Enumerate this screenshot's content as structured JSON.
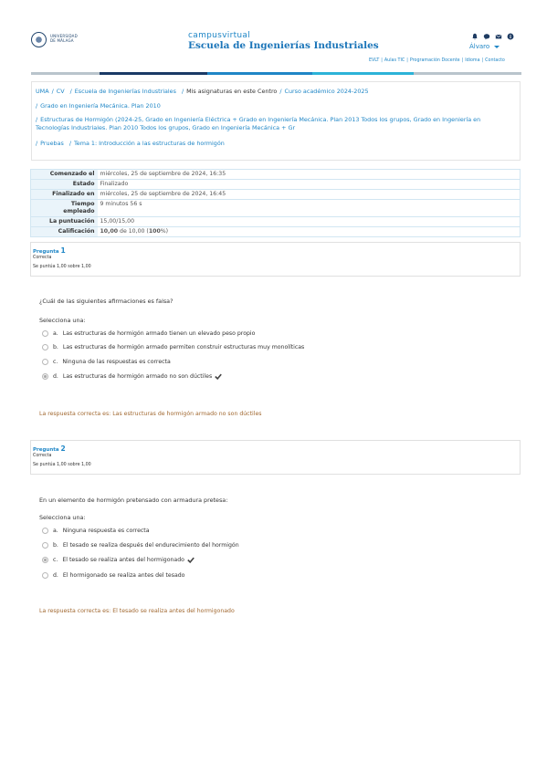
{
  "header": {
    "logo_text": "UNIVERSIDAD DE MÁLAGA",
    "site_sub": "campusvirtual",
    "site_title": "Escuela de Ingenierías Industriales",
    "user_name": "Álvaro",
    "icons": [
      "bell-icon",
      "chat-icon",
      "envelope-icon",
      "info-icon"
    ],
    "links": [
      "EVLT",
      "Aulas TIC",
      "Programación Docente",
      "Idioma",
      "Contacto"
    ]
  },
  "colorbar": [
    "#b9c4cc",
    "#1a3a66",
    "#1f86c6",
    "#2cb3d8",
    "#b9c4cc"
  ],
  "breadcrumb": {
    "line1": [
      {
        "text": "UMA",
        "link": true
      },
      {
        "text": "CV",
        "link": true
      },
      {
        "text": "Escuela de Ingenierías Industriales",
        "link": true
      },
      {
        "text": "Mis asignaturas en este Centro",
        "link": false
      },
      {
        "text": "Curso académico 2024-2025",
        "link": true
      }
    ],
    "line2": "Grado en Ingeniería Mecánica. Plan 2010",
    "line3": "Estructuras de Hormigón (2024-25, Grado en Ingeniería Eléctrica + Grado en Ingeniería Mecánica. Plan 2013 Todos los grupos, Grado en Ingeniería en Tecnologías Industriales. Plan 2010 Todos los grupos, Grado en Ingeniería Mecánica + Gr",
    "line4": [
      {
        "text": "Pruebas"
      },
      {
        "text": "Tema 1: Introducción a las estructuras de hormigón"
      }
    ]
  },
  "summary": [
    {
      "label": "Comenzado el",
      "value": "miércoles, 25 de septiembre de 2024, 16:35"
    },
    {
      "label": "Estado",
      "value": "Finalizado"
    },
    {
      "label": "Finalizado en",
      "value": "miércoles, 25 de septiembre de 2024, 16:45"
    },
    {
      "label": "Tiempo empleado",
      "value": "9 minutos 56 s"
    },
    {
      "label": "La puntuación",
      "value": "15,00/15,00"
    },
    {
      "label": "Calificación",
      "value_bold1": "10,00",
      "value_mid": " de 10,00 (",
      "value_bold2": "100",
      "value_end": "%)"
    }
  ],
  "questions": [
    {
      "label": "Pregunta",
      "number": "1",
      "state": "Correcta",
      "grade": "Se puntúa 1,00 sobre 1,00",
      "text": "¿Cuál de las siguientes afirmaciones es falsa?",
      "prompt": "Selecciona una:",
      "answers": [
        {
          "letter": "a.",
          "text": "Las estructuras de hormigón armado tienen un elevado peso propio",
          "selected": false
        },
        {
          "letter": "b.",
          "text": "Las estructuras de hormigón armado permiten construir estructuras muy monolíticas",
          "selected": false
        },
        {
          "letter": "c.",
          "text": "Ninguna de las respuestas es correcta",
          "selected": false
        },
        {
          "letter": "d.",
          "text": "Las estructuras de hormigón armado no son dúctiles",
          "selected": true
        }
      ],
      "right_answer": "La respuesta correcta es: Las estructuras de hormigón armado no son dúctiles"
    },
    {
      "label": "Pregunta",
      "number": "2",
      "state": "Correcta",
      "grade": "Se puntúa 1,00 sobre 1,00",
      "text": "En un elemento de hormigón pretensado con armadura pretesa:",
      "prompt": "Selecciona una:",
      "answers": [
        {
          "letter": "a.",
          "text": "Ninguna respuesta es correcta",
          "selected": false
        },
        {
          "letter": "b.",
          "text": "El tesado se realiza después del endurecimiento del hormigón",
          "selected": false
        },
        {
          "letter": "c.",
          "text": "El tesado se realiza antes del hormigonado",
          "selected": true
        },
        {
          "letter": "d.",
          "text": "El hormigonado se realiza antes del tesado",
          "selected": false
        }
      ],
      "right_answer": "La respuesta correcta es: El tesado se realiza antes del hormigonado"
    }
  ]
}
